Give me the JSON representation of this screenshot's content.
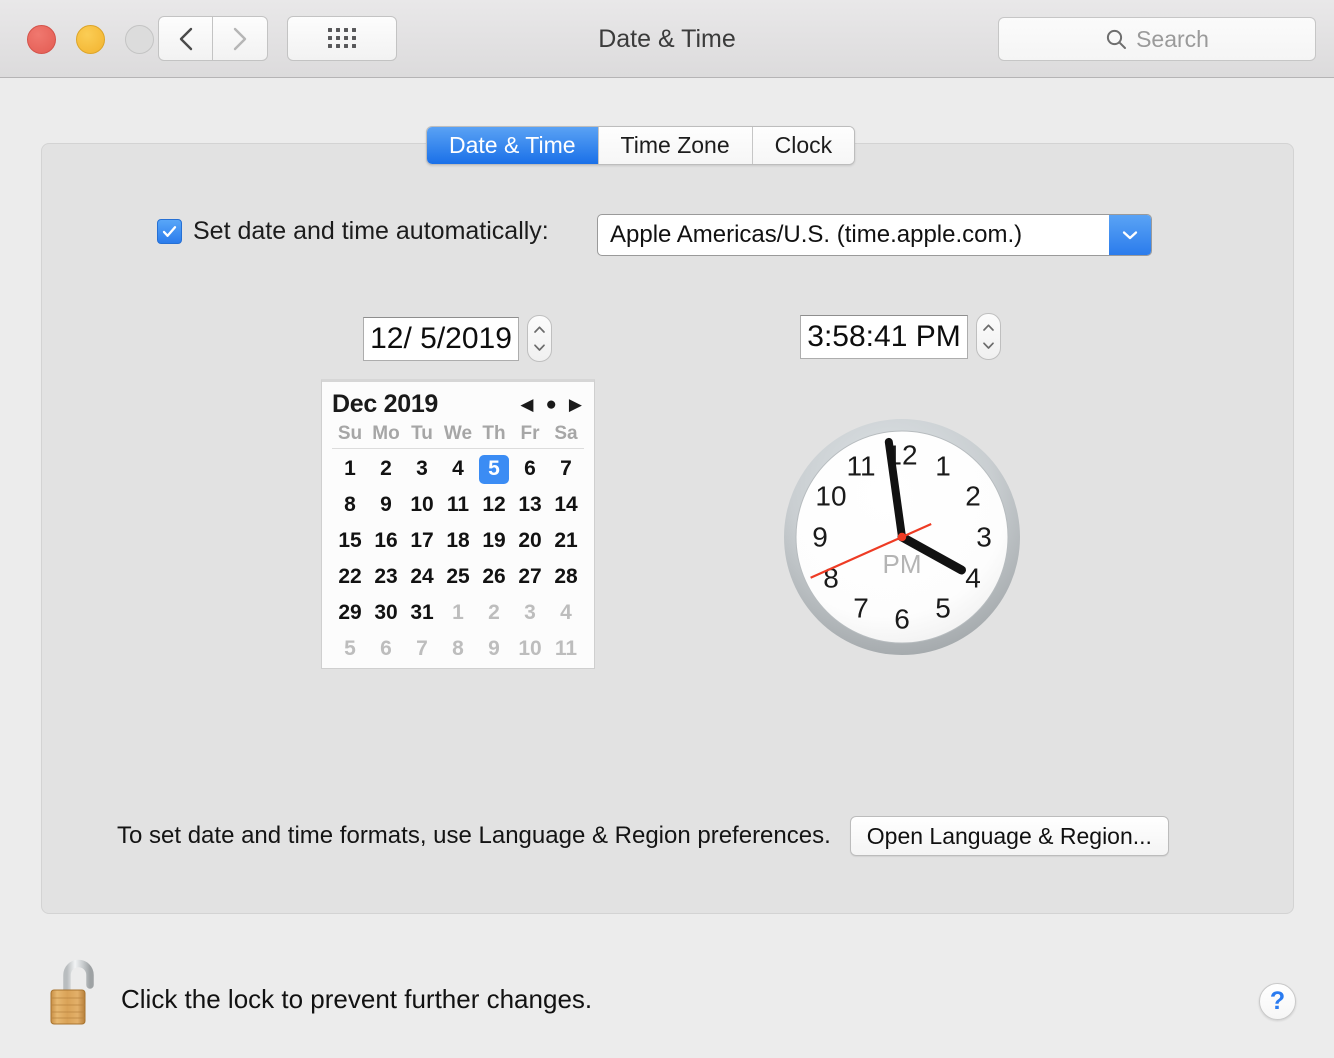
{
  "window": {
    "title": "Date & Time",
    "traffic_lights": [
      "close",
      "minimize",
      "zoom"
    ],
    "nav": {
      "back_icon": "chevron-left-icon",
      "forward_icon": "chevron-right-icon"
    },
    "grid_button_icon": "grid-view-icon"
  },
  "search": {
    "placeholder": "Search",
    "icon": "search-icon"
  },
  "tabs": [
    {
      "label": "Date & Time",
      "active": true
    },
    {
      "label": "Time Zone",
      "active": false
    },
    {
      "label": "Clock",
      "active": false
    }
  ],
  "auto_row": {
    "checkbox_checked": true,
    "checkbox_icon": "checkmark-icon",
    "label": "Set date and time automatically:",
    "server_value": "Apple Americas/U.S. (time.apple.com.)",
    "server_arrow_icon": "chevron-down-icon"
  },
  "date_field": {
    "value": "12/  5/2019",
    "stepper_up_icon": "chevron-up-icon",
    "stepper_down_icon": "chevron-down-icon"
  },
  "time_field": {
    "value": "3:58:41 PM",
    "stepper_up_icon": "chevron-up-icon",
    "stepper_down_icon": "chevron-down-icon"
  },
  "calendar": {
    "month_label": "Dec 2019",
    "nav": {
      "prev_icon": "triangle-left-icon",
      "today_icon": "dot-icon",
      "next_icon": "triangle-right-icon",
      "prev": "◀",
      "today": "●",
      "next": "▶"
    },
    "day_headers": [
      "Su",
      "Mo",
      "Tu",
      "We",
      "Th",
      "Fr",
      "Sa"
    ],
    "selected_day": 5,
    "weeks": [
      [
        {
          "n": "1",
          "muted": false
        },
        {
          "n": "2",
          "muted": false
        },
        {
          "n": "3",
          "muted": false
        },
        {
          "n": "4",
          "muted": false
        },
        {
          "n": "5",
          "muted": false,
          "selected": true
        },
        {
          "n": "6",
          "muted": false
        },
        {
          "n": "7",
          "muted": false
        }
      ],
      [
        {
          "n": "8",
          "muted": false
        },
        {
          "n": "9",
          "muted": false
        },
        {
          "n": "10",
          "muted": false
        },
        {
          "n": "11",
          "muted": false
        },
        {
          "n": "12",
          "muted": false
        },
        {
          "n": "13",
          "muted": false
        },
        {
          "n": "14",
          "muted": false
        }
      ],
      [
        {
          "n": "15",
          "muted": false
        },
        {
          "n": "16",
          "muted": false
        },
        {
          "n": "17",
          "muted": false
        },
        {
          "n": "18",
          "muted": false
        },
        {
          "n": "19",
          "muted": false
        },
        {
          "n": "20",
          "muted": false
        },
        {
          "n": "21",
          "muted": false
        }
      ],
      [
        {
          "n": "22",
          "muted": false
        },
        {
          "n": "23",
          "muted": false
        },
        {
          "n": "24",
          "muted": false
        },
        {
          "n": "25",
          "muted": false
        },
        {
          "n": "26",
          "muted": false
        },
        {
          "n": "27",
          "muted": false
        },
        {
          "n": "28",
          "muted": false
        }
      ],
      [
        {
          "n": "29",
          "muted": false
        },
        {
          "n": "30",
          "muted": false
        },
        {
          "n": "31",
          "muted": false
        },
        {
          "n": "1",
          "muted": true
        },
        {
          "n": "2",
          "muted": true
        },
        {
          "n": "3",
          "muted": true
        },
        {
          "n": "4",
          "muted": true
        }
      ],
      [
        {
          "n": "5",
          "muted": true
        },
        {
          "n": "6",
          "muted": true
        },
        {
          "n": "7",
          "muted": true
        },
        {
          "n": "8",
          "muted": true
        },
        {
          "n": "9",
          "muted": true
        },
        {
          "n": "10",
          "muted": true
        },
        {
          "n": "11",
          "muted": true
        }
      ]
    ]
  },
  "clock": {
    "period_label": "PM",
    "hour_numerals": [
      "12",
      "1",
      "2",
      "3",
      "4",
      "5",
      "6",
      "7",
      "8",
      "9",
      "10",
      "11"
    ],
    "hour": 3,
    "minute": 58,
    "second": 41,
    "second_hand_color": "#ee3b24"
  },
  "format_row": {
    "text": "To set date and time formats, use Language & Region preferences.",
    "button_label": "Open Language & Region..."
  },
  "footer": {
    "lock_icon": "unlocked-padlock-icon",
    "lock_text": "Click the lock to prevent further changes.",
    "help_label": "?",
    "help_icon": "question-mark-icon"
  },
  "colors": {
    "accent_blue": "#2b7cec",
    "selection_blue": "#3b8cf4",
    "window_bg": "#ececec",
    "panel_bg": "#e2e2e2"
  }
}
